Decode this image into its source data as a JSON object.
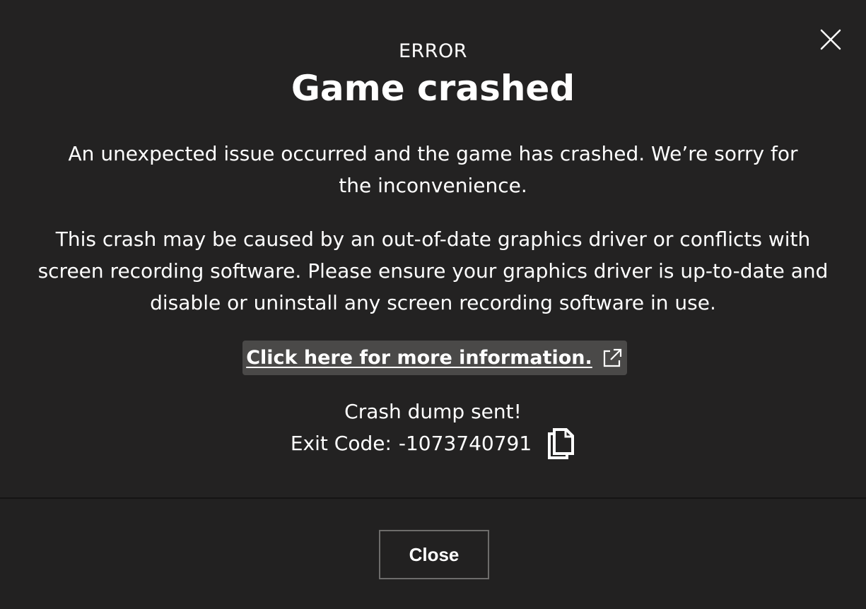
{
  "dialog": {
    "label": "ERROR",
    "title": "Game crashed",
    "message_1": "An unexpected issue occurred and the game has crashed. We’re sorry for the inconvenience.",
    "message_2": "This crash may be caused by an out-of-date graphics driver or conflicts with screen recording software. Please ensure your graphics driver is up-to-date and disable or uninstall any screen recording software in use.",
    "info_link": "Click here for more information.",
    "dump_status": "Crash dump sent!",
    "exit_code_label": "Exit Code:",
    "exit_code_value": "-1073740791",
    "close_button": "Close"
  },
  "icons": {
    "close": "close-icon",
    "external_link": "external-link-icon",
    "copy": "copy-icon"
  },
  "colors": {
    "background": "#222121",
    "text": "#ffffff",
    "link_background": "#4a4948",
    "button_border": "#6d6c6b"
  }
}
